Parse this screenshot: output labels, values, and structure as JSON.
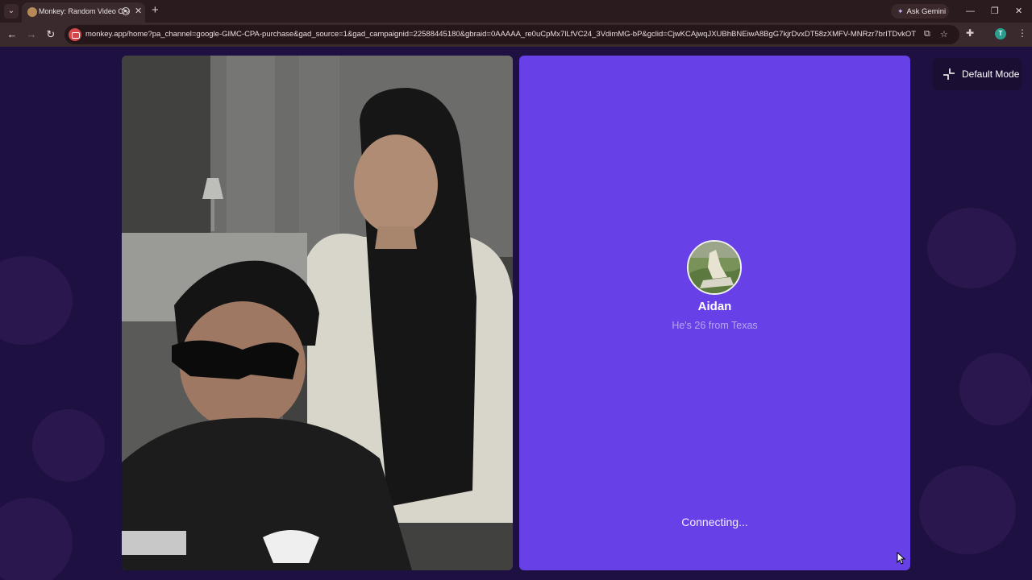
{
  "browser": {
    "tab_title": "Monkey: Random Video Chat",
    "url": "monkey.app/home?pa_channel=google-GIMC-CPA-purchase&gad_source=1&gad_campaignid=22588445180&gbraid=0AAAAA_re0uCpMx7lLfVC24_3VdimMG-bP&gclid=CjwKCAjwqJXUBhBNEiwA8BgG7kjrDvxDT58zXMFV-MNRzr7brITDvkOT6oYPln...",
    "ask_gemini": "Ask Gemini",
    "profile_initial": "T"
  },
  "mode_button": {
    "label": "Default Mode"
  },
  "match": {
    "name": "Aidan",
    "info": "He's 26 from Texas",
    "status": "Connecting..."
  },
  "colors": {
    "page_background": "#1e1040",
    "match_panel": "#6741e7",
    "browser_frame": "#3b2a2d"
  },
  "icons": {
    "tab_list": "chevron-down-icon",
    "favicon": "monkey-icon",
    "audio": "audio-playing-icon",
    "new_tab": "plus-icon",
    "gemini": "sparkle-icon",
    "back": "arrow-left-icon",
    "forward": "arrow-right-icon",
    "reload": "reload-icon",
    "site": "camera-permission-icon",
    "install": "install-app-icon",
    "bookmark": "star-icon",
    "extensions": "puzzle-icon",
    "menu": "more-vertical-icon",
    "mode": "collapse-icon"
  }
}
